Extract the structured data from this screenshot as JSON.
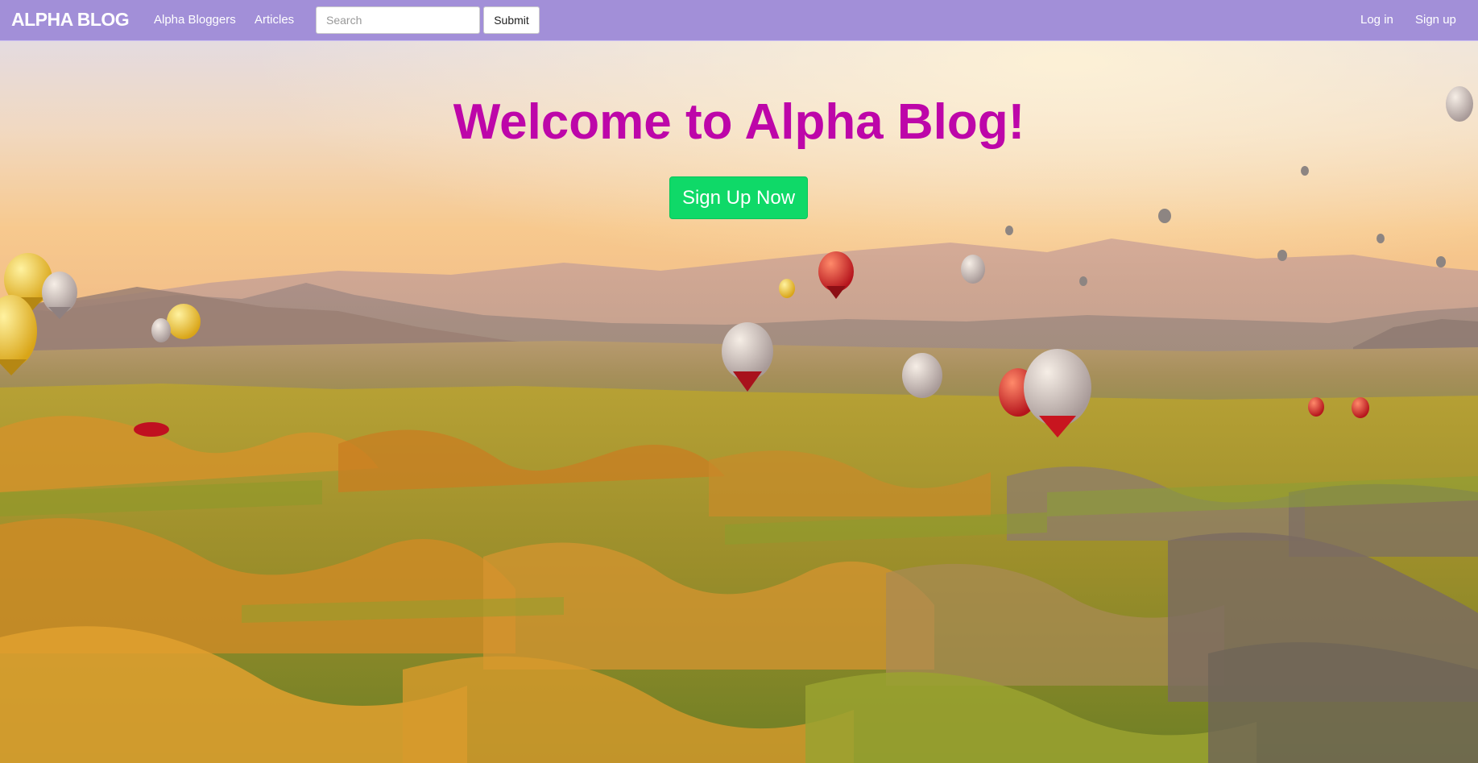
{
  "navbar": {
    "brand": "ALPHA BLOG",
    "links": [
      {
        "label": "Alpha Bloggers"
      },
      {
        "label": "Articles"
      }
    ],
    "search": {
      "placeholder": "Search",
      "value": ""
    },
    "submit_label": "Submit",
    "right_links": [
      {
        "label": "Log in"
      },
      {
        "label": "Sign up"
      }
    ],
    "background_color": "#a28fd8"
  },
  "hero": {
    "title": "Welcome to Alpha Blog!",
    "title_color": "#bd06a9",
    "cta_label": "Sign Up Now",
    "cta_color": "#0fd968",
    "background_description_icon": "hot-air-balloon-landscape-image"
  }
}
